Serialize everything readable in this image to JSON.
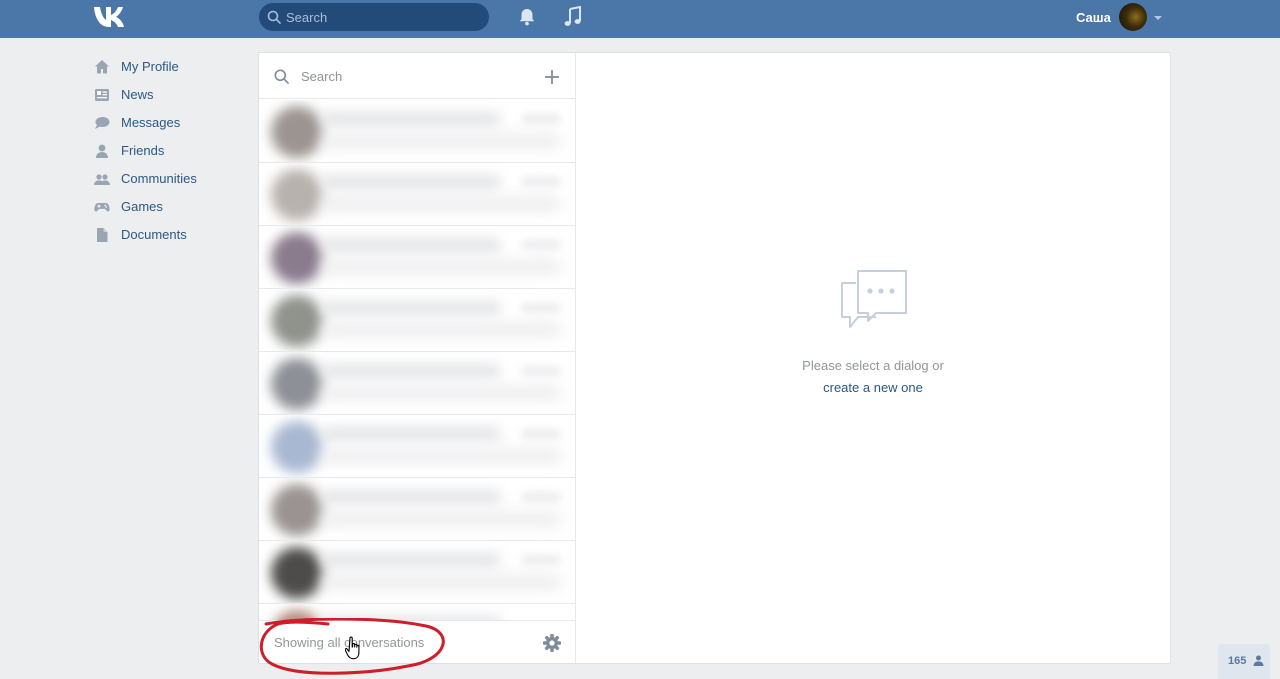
{
  "header": {
    "search_placeholder": "Search",
    "user_name": "Саша"
  },
  "nav": {
    "items": [
      {
        "label": "My Profile",
        "icon": "home-icon"
      },
      {
        "label": "News",
        "icon": "news-icon"
      },
      {
        "label": "Messages",
        "icon": "messages-icon"
      },
      {
        "label": "Friends",
        "icon": "friends-icon"
      },
      {
        "label": "Communities",
        "icon": "communities-icon"
      },
      {
        "label": "Games",
        "icon": "games-icon"
      },
      {
        "label": "Documents",
        "icon": "documents-icon"
      }
    ]
  },
  "dialogs": {
    "search_placeholder": "Search",
    "footer_filter": "Showing all conversations"
  },
  "empty_state": {
    "message": "Please select a dialog or",
    "link": "create a new one"
  },
  "online": {
    "count": "165"
  },
  "colors": {
    "header": "#4a76a8",
    "link": "#2a5885",
    "annotation": "#cc1f2a"
  }
}
